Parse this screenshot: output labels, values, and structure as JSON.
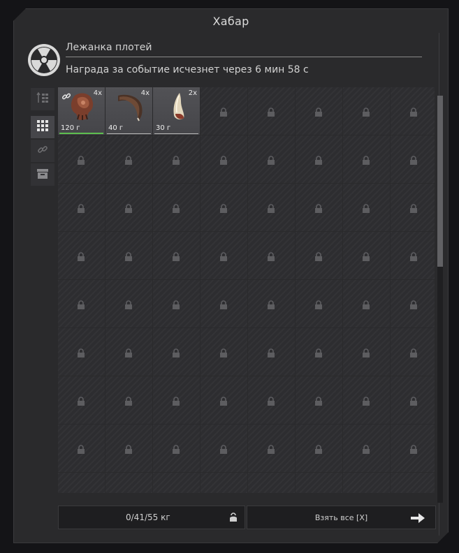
{
  "window": {
    "title": "Хабар"
  },
  "source": {
    "name": "Лежанка плотей",
    "timer_text": "Награда за событие исчезнет через 6 мин 58 с"
  },
  "side_tabs": [
    {
      "icon": "sort-icon",
      "active": false
    },
    {
      "icon": "grid-icon",
      "active": true
    },
    {
      "icon": "link-icon",
      "active": false
    },
    {
      "icon": "box-icon",
      "active": false
    }
  ],
  "items": [
    {
      "name": "item-flesh-paw",
      "qty": "4x",
      "weight": "120 г"
    },
    {
      "name": "item-horn",
      "qty": "4x",
      "weight": "40 г"
    },
    {
      "name": "item-claw",
      "qty": "2x",
      "weight": "30 г"
    }
  ],
  "footer": {
    "weight": "0/41/55 кг",
    "take_all_label": "Взять все [X]"
  },
  "colors": {
    "accent_green": "#5dbf4f",
    "panel": "#2a2a2c"
  }
}
